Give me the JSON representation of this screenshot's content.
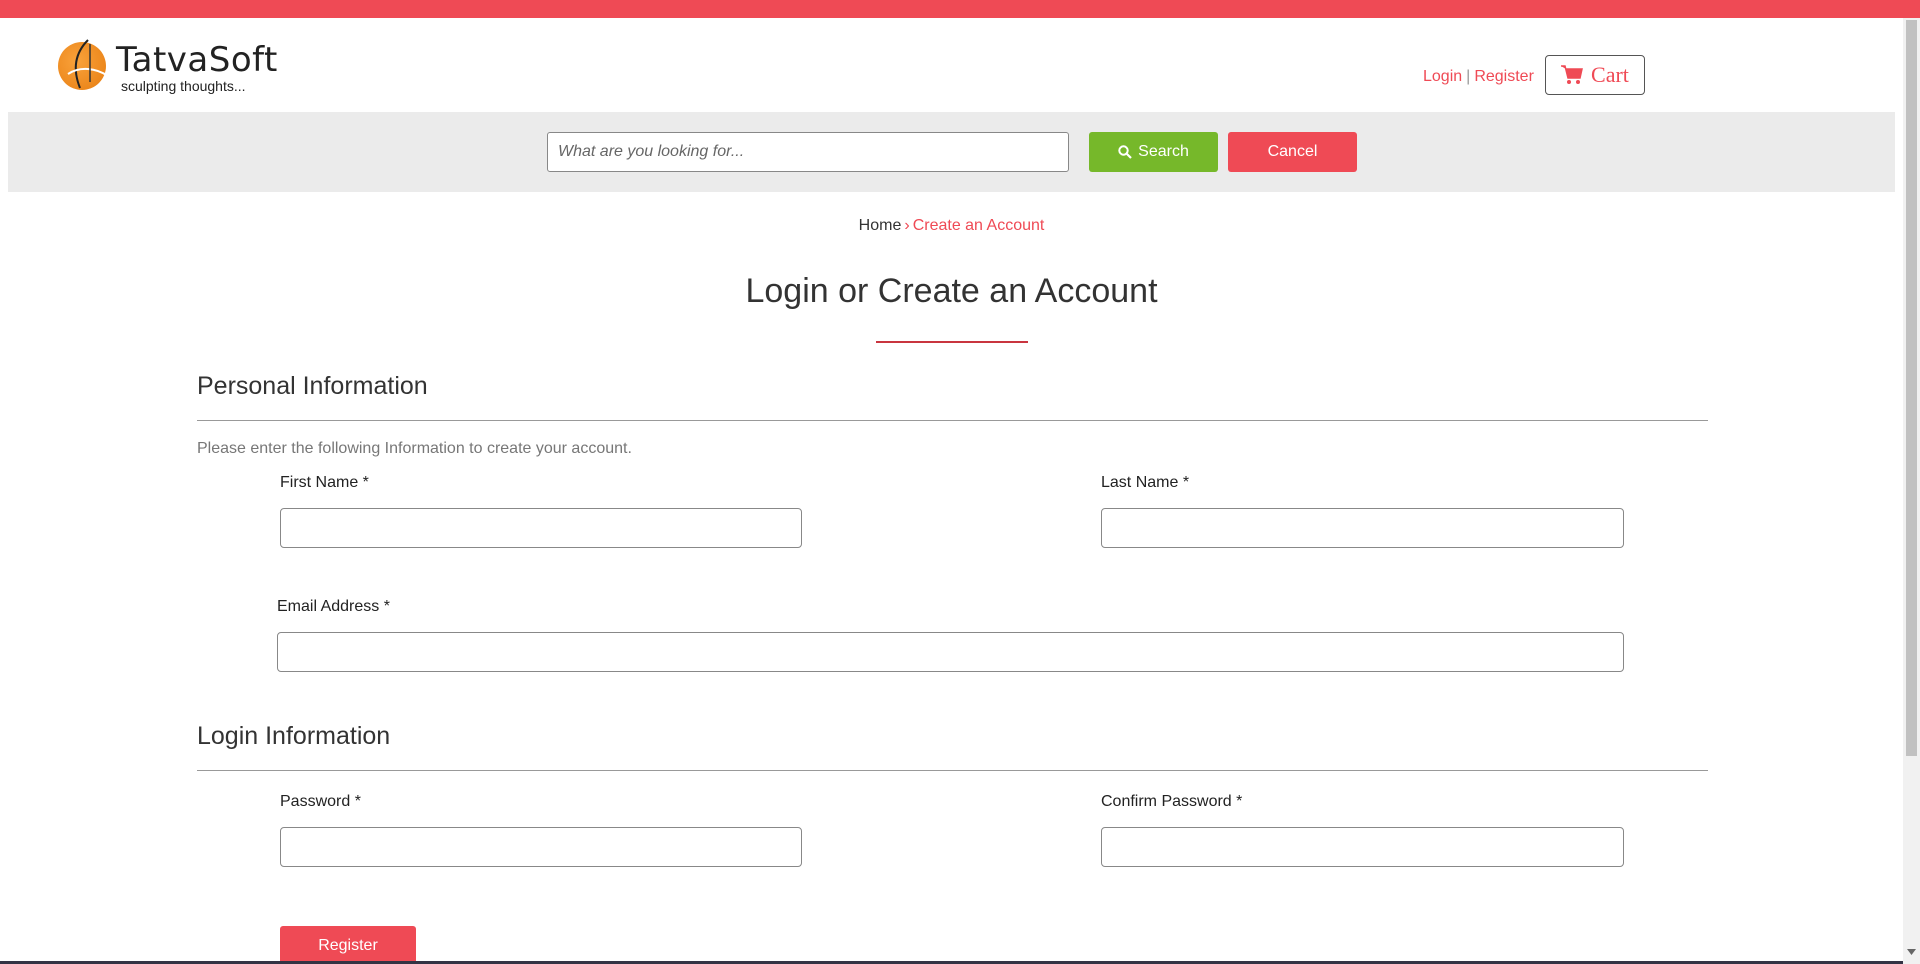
{
  "brand": {
    "name": "TatvaSoft",
    "tagline": "sculpting thoughts...",
    "accent_color": "#ef4a55"
  },
  "header": {
    "login_label": "Login",
    "separator": "|",
    "register_label": "Register",
    "cart_label": "Cart",
    "cart_icon": "shopping-cart-icon"
  },
  "search": {
    "placeholder": "What are you looking for...",
    "value": "",
    "search_label": "Search",
    "search_icon": "magnifier-icon",
    "search_color": "#76b82a",
    "cancel_label": "Cancel"
  },
  "breadcrumb": {
    "home": "Home",
    "separator": "›",
    "current": "Create an Account"
  },
  "page_title": "Login or Create an Account",
  "personal": {
    "title": "Personal Information",
    "hint": "Please enter the following Information to create your account.",
    "first_name_label": "First Name *",
    "first_name_value": "",
    "last_name_label": "Last Name *",
    "last_name_value": "",
    "email_label": "Email Address *",
    "email_value": ""
  },
  "login": {
    "title": "Login Information",
    "password_label": "Password *",
    "password_value": "",
    "confirm_label": "Confirm Password *",
    "confirm_value": ""
  },
  "register_button": "Register"
}
